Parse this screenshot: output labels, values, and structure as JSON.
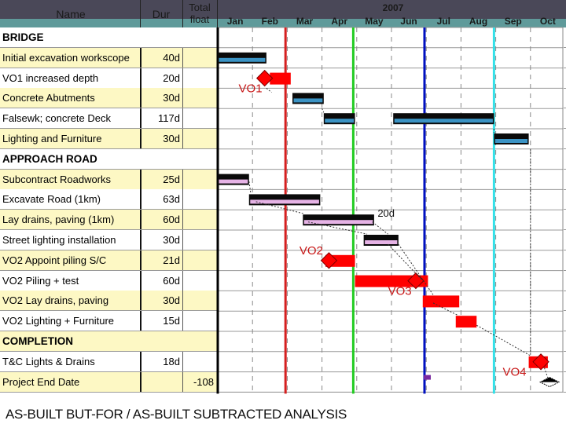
{
  "header": {
    "name_label": "Name",
    "dur_label": "Dur",
    "tf_label_1": "Total",
    "tf_label_2": "float",
    "year": "2007",
    "months": [
      "Jan",
      "Feb",
      "Mar",
      "Apr",
      "May",
      "Jun",
      "Jul",
      "Aug",
      "Sep",
      "Oct"
    ]
  },
  "rows": [
    {
      "name": "BRIDGE",
      "dur": "",
      "tf": "",
      "section": true,
      "shade": "white"
    },
    {
      "name": "Initial excavation workscope",
      "dur": "40d",
      "tf": "",
      "section": false,
      "shade": "yellow"
    },
    {
      "name": "VO1 increased depth",
      "dur": "20d",
      "tf": "",
      "section": false,
      "shade": "white"
    },
    {
      "name": "Concrete Abutments",
      "dur": "30d",
      "tf": "",
      "section": false,
      "shade": "yellow"
    },
    {
      "name": "Falsewk; concrete Deck",
      "dur": "117d",
      "tf": "",
      "section": false,
      "shade": "white"
    },
    {
      "name": "Lighting and Furniture",
      "dur": "30d",
      "tf": "",
      "section": false,
      "shade": "yellow"
    },
    {
      "name": "APPROACH ROAD",
      "dur": "",
      "tf": "",
      "section": true,
      "shade": "white"
    },
    {
      "name": "Subcontract Roadworks",
      "dur": "25d",
      "tf": "",
      "section": false,
      "shade": "yellow"
    },
    {
      "name": "Excavate Road (1km)",
      "dur": "63d",
      "tf": "",
      "section": false,
      "shade": "white"
    },
    {
      "name": "Lay drains, paving (1km)",
      "dur": "60d",
      "tf": "",
      "section": false,
      "shade": "yellow"
    },
    {
      "name": "Street lighting installation",
      "dur": "30d",
      "tf": "",
      "section": false,
      "shade": "white"
    },
    {
      "name": "VO2 Appoint piling S/C",
      "dur": "21d",
      "tf": "",
      "section": false,
      "shade": "yellow"
    },
    {
      "name": "VO2 Piling + test",
      "dur": "60d",
      "tf": "",
      "section": false,
      "shade": "white"
    },
    {
      "name": "VO2 Lay drains, paving",
      "dur": "30d",
      "tf": "",
      "section": false,
      "shade": "yellow"
    },
    {
      "name": "VO2 Lighting + Furniture",
      "dur": "15d",
      "tf": "",
      "section": false,
      "shade": "white"
    },
    {
      "name": "COMPLETION",
      "dur": "",
      "tf": "",
      "section": true,
      "shade": "yellow"
    },
    {
      "name": "T&C Lights & Drains",
      "dur": "18d",
      "tf": "",
      "section": false,
      "shade": "white"
    },
    {
      "name": "Project End Date",
      "dur": "",
      "tf": "-108",
      "section": false,
      "shade": "yellow"
    }
  ],
  "colors": {
    "bridge_bar": "#3b93c4",
    "road_bar": "#e6b3e6",
    "vo_bar": "#ff0000",
    "header_bg": "#4a4858",
    "header_teal": "#5f9a9a",
    "row_yellow": "#fdf8c4"
  },
  "chart_data": {
    "type": "gantt",
    "title": "2007",
    "xlabel": "",
    "ylabel": "",
    "x_axis": {
      "unit": "month",
      "start": "Jan 2007",
      "end": "Oct 2007",
      "ticks": [
        "Jan",
        "Feb",
        "Mar",
        "Apr",
        "May",
        "Jun",
        "Jul",
        "Aug",
        "Sep",
        "Oct"
      ]
    },
    "vertical_lines": [
      {
        "name": "start-line",
        "month": 0.0,
        "color": "#000000"
      },
      {
        "name": "vo1-line",
        "month": 1.95,
        "color": "#d42020"
      },
      {
        "name": "vo2-line",
        "month": 3.9,
        "color": "#22cc22"
      },
      {
        "name": "vo3-line",
        "month": 5.95,
        "color": "#0010c0"
      },
      {
        "name": "vo4-line",
        "month": 7.95,
        "color": "#33e0e8"
      }
    ],
    "bars": [
      {
        "row": 1,
        "start": 0.0,
        "end": 1.4,
        "kind": "bridge"
      },
      {
        "row": 2,
        "start": 1.5,
        "end": 2.1,
        "kind": "vo"
      },
      {
        "row": 3,
        "start": 2.15,
        "end": 3.05,
        "kind": "bridge"
      },
      {
        "row": 4,
        "start": 3.05,
        "end": 3.95,
        "kind": "bridge"
      },
      {
        "row": 4,
        "start": 5.05,
        "end": 7.95,
        "kind": "bridge"
      },
      {
        "row": 5,
        "start": 7.95,
        "end": 8.95,
        "kind": "bridge"
      },
      {
        "row": 7,
        "start": 0.0,
        "end": 0.9,
        "kind": "road"
      },
      {
        "row": 8,
        "start": 0.9,
        "end": 2.95,
        "kind": "road"
      },
      {
        "row": 9,
        "start": 2.45,
        "end": 4.5,
        "kind": "road"
      },
      {
        "row": 10,
        "start": 4.2,
        "end": 5.2,
        "kind": "road"
      },
      {
        "row": 11,
        "start": 3.1,
        "end": 3.95,
        "kind": "vo"
      },
      {
        "row": 12,
        "start": 3.95,
        "end": 6.05,
        "kind": "vo"
      },
      {
        "row": 13,
        "start": 5.9,
        "end": 6.95,
        "kind": "vo"
      },
      {
        "row": 14,
        "start": 6.85,
        "end": 7.45,
        "kind": "vo"
      },
      {
        "row": 16,
        "start": 8.95,
        "end": 9.5,
        "kind": "vo"
      }
    ],
    "milestones": [
      {
        "row": 2,
        "month": 1.35,
        "color": "#ff0000"
      },
      {
        "row": 11,
        "month": 3.2,
        "color": "#ff0000"
      },
      {
        "row": 12,
        "month": 5.7,
        "color": "#ff0000"
      },
      {
        "row": 16,
        "month": 9.3,
        "color": "#ff0000"
      },
      {
        "row": 17,
        "month": 9.55,
        "color": "#000000"
      }
    ],
    "annotations": [
      {
        "text": "VO1",
        "row": 3,
        "month": 0.6
      },
      {
        "text": "20d",
        "row": 9,
        "month": 4.6
      },
      {
        "text": "VO2",
        "row": 11,
        "month": 2.35
      },
      {
        "text": "VO3",
        "row": 13,
        "month": 4.9
      },
      {
        "text": "VO4",
        "row": 17,
        "month": 8.2
      }
    ]
  },
  "caption": "AS-BUILT BUT-FOR / AS-BUILT SUBTRACTED ANALYSIS"
}
